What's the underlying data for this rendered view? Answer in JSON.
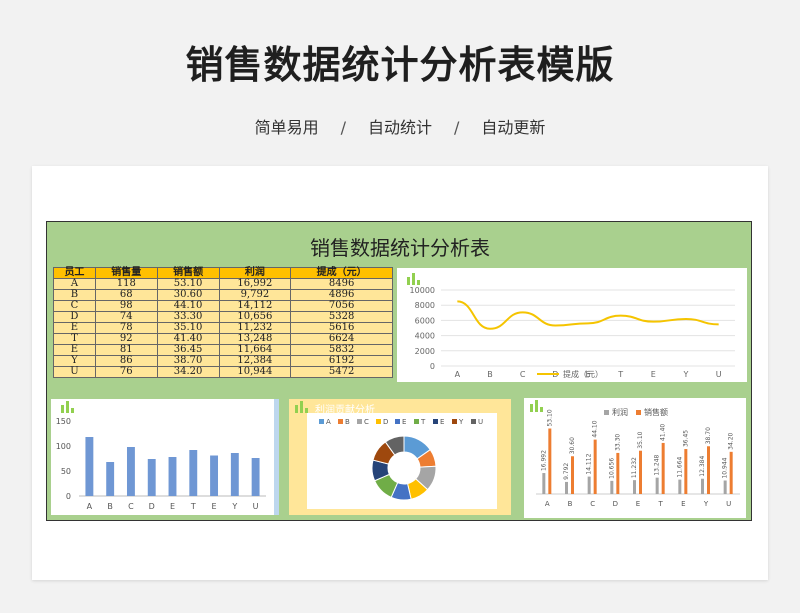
{
  "hero": {
    "title": "销售数据统计分析表模版",
    "tags": [
      "简单易用",
      "自动统计",
      "自动更新"
    ],
    "separator": "/"
  },
  "sheet": {
    "title": "销售数据统计分析表",
    "table": {
      "headers": [
        "员工",
        "销售量",
        "销售额",
        "利润",
        "提成（元）"
      ],
      "rows": [
        [
          "A",
          "118",
          "53.10",
          "16,992",
          "8496"
        ],
        [
          "B",
          "68",
          "30.60",
          "9,792",
          "4896"
        ],
        [
          "C",
          "98",
          "44.10",
          "14,112",
          "7056"
        ],
        [
          "D",
          "74",
          "33.30",
          "10,656",
          "5328"
        ],
        [
          "E",
          "78",
          "35.10",
          "11,232",
          "5616"
        ],
        [
          "T",
          "92",
          "41.40",
          "13,248",
          "6624"
        ],
        [
          "E",
          "81",
          "36.45",
          "11,664",
          "5832"
        ],
        [
          "Y",
          "86",
          "38.70",
          "12,384",
          "6192"
        ],
        [
          "U",
          "76",
          "34.20",
          "10,944",
          "5472"
        ]
      ]
    }
  },
  "chart_data": [
    {
      "type": "line",
      "categories": [
        "A",
        "B",
        "C",
        "D",
        "E",
        "T",
        "E",
        "Y",
        "U"
      ],
      "series": [
        {
          "name": "提成（元）",
          "values": [
            8496,
            4896,
            7056,
            5328,
            5616,
            6624,
            5832,
            6192,
            5472
          ]
        }
      ],
      "yticks": [
        "0",
        "2000",
        "4000",
        "6000",
        "8000",
        "10000"
      ],
      "ylim": [
        0,
        10000
      ],
      "color": "#f5c400",
      "legend_position": "bottom"
    },
    {
      "type": "bar",
      "categories": [
        "A",
        "B",
        "C",
        "D",
        "E",
        "T",
        "E",
        "Y",
        "U"
      ],
      "values": [
        118,
        68,
        98,
        74,
        78,
        92,
        81,
        86,
        76
      ],
      "yticks": [
        "0",
        "50",
        "100",
        "150"
      ],
      "ylim": [
        0,
        150
      ],
      "color": "#6f97d4"
    },
    {
      "type": "pie",
      "title": "利润贡献分析",
      "categories": [
        "A",
        "B",
        "C",
        "D",
        "E",
        "T",
        "E",
        "Y",
        "U"
      ],
      "values": [
        16992,
        9792,
        14112,
        10656,
        11232,
        13248,
        11664,
        12384,
        10944
      ],
      "colors": [
        "#5b9bd5",
        "#ed7d31",
        "#a5a5a5",
        "#ffc000",
        "#4472c4",
        "#70ad47",
        "#264478",
        "#9e480e",
        "#636363"
      ],
      "legend_position": "top"
    },
    {
      "type": "bar",
      "categories": [
        "A",
        "B",
        "C",
        "D",
        "E",
        "T",
        "E",
        "Y",
        "U"
      ],
      "series": [
        {
          "name": "利润",
          "values": [
            16.992,
            9.792,
            14.112,
            10.656,
            11.232,
            13.248,
            11.664,
            12.384,
            10.944
          ],
          "labels": [
            "16.992",
            "9.792",
            "14.112",
            "10.656",
            "11.232",
            "13.248",
            "11.664",
            "12.384",
            "10.944"
          ],
          "color": "#a5a5a5"
        },
        {
          "name": "销售额",
          "values": [
            53.1,
            30.6,
            44.1,
            33.3,
            35.1,
            41.4,
            36.45,
            38.7,
            34.2
          ],
          "labels": [
            "53.10",
            "30.60",
            "44.10",
            "33.30",
            "35.10",
            "41.40",
            "36.45",
            "38.70",
            "34.20"
          ],
          "color": "#ed7d31"
        }
      ],
      "legend_position": "top"
    }
  ]
}
